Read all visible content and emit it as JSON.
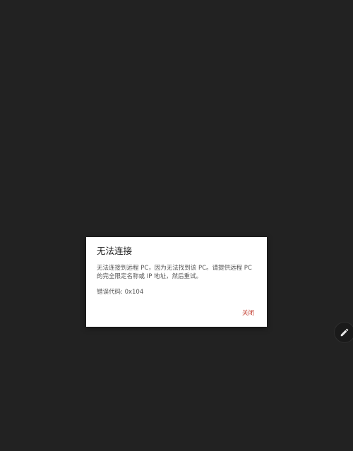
{
  "dialog": {
    "title": "无法连接",
    "message": "无法连接到远程 PC，因为无法找到该 PC。请提供远程 PC 的完全限定名称或 IP 地址，然后重试。",
    "error_code": "错误代码: 0x104",
    "close_label": "关闭"
  },
  "fab": {
    "icon": "pencil-icon"
  },
  "colors": {
    "background": "#222222",
    "dialog_background": "#ffffff",
    "accent": "#c0392b"
  }
}
